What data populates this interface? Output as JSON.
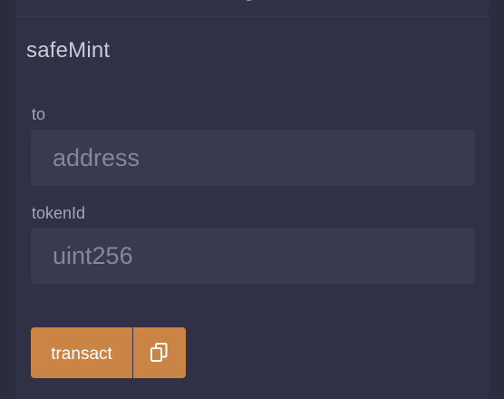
{
  "function": {
    "title": "safeMint"
  },
  "params": [
    {
      "label": "to",
      "placeholder": "address",
      "value": ""
    },
    {
      "label": "tokenId",
      "placeholder": "uint256",
      "value": ""
    }
  ],
  "actions": {
    "transact_label": "transact",
    "copy_icon": "copy-icon"
  },
  "colors": {
    "background": "#2a2c3f",
    "panel": "#303146",
    "input_bg": "#393a50",
    "accent": "#c98446",
    "text": "#c9cbd8",
    "label_text": "#a3a6b8",
    "placeholder_text": "#858799"
  }
}
